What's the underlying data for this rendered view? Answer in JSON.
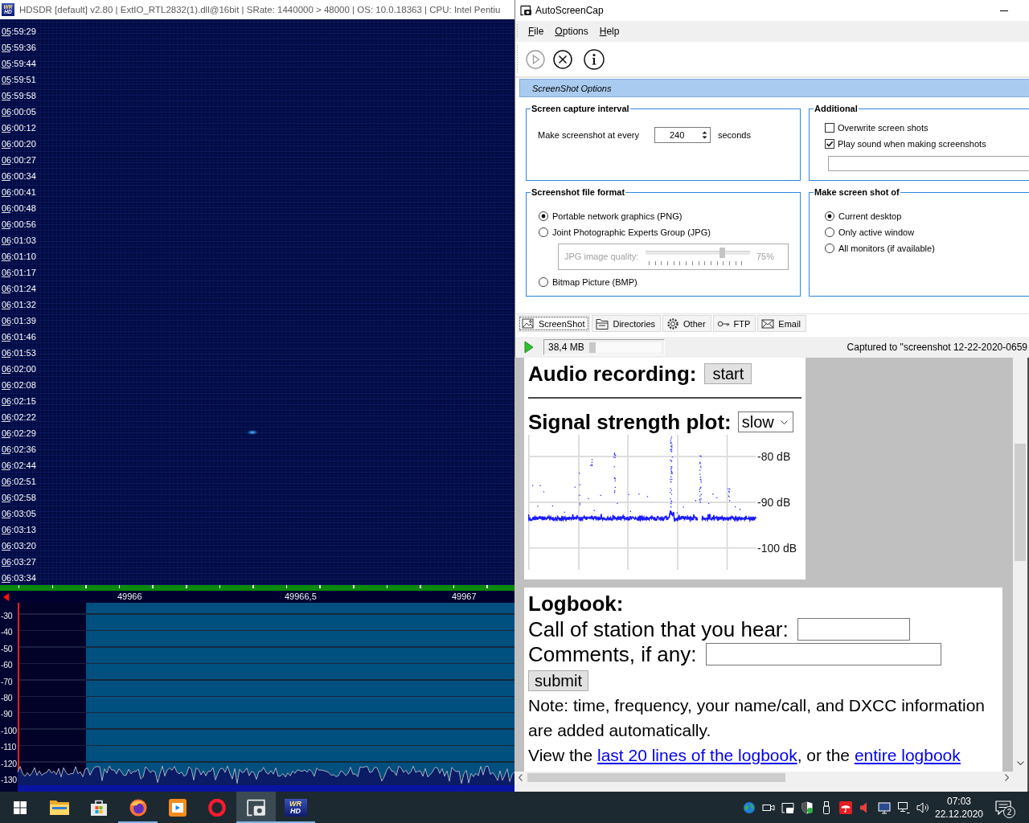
{
  "hdsdr": {
    "logo": [
      "WR",
      "HD"
    ],
    "title": "HDSDR [default] v2.80 | ExtIO_RTL2832(1).dll@16bit | SRate: 1440000 > 48000 | OS: 10.0.18363 | CPU: Intel Pentiu",
    "times": [
      "05:59:29",
      "05:59:36",
      "05:59:44",
      "05:59:51",
      "05:59:58",
      "06:00:05",
      "06:00:12",
      "06:00:20",
      "06:00:27",
      "06:00:34",
      "06:00:41",
      "06:00:48",
      "06:00:56",
      "06:01:03",
      "06:01:10",
      "06:01:17",
      "06:01:24",
      "06:01:32",
      "06:01:39",
      "06:01:46",
      "06:01:53",
      "06:02:00",
      "06:02:08",
      "06:02:15",
      "06:02:22",
      "06:02:29",
      "06:02:36",
      "06:02:44",
      "06:02:51",
      "06:02:58",
      "06:03:05",
      "06:03:13",
      "06:03:20",
      "06:03:27",
      "06:03:34"
    ],
    "frequency_labels": [
      "49966",
      "49966,5",
      "49967"
    ],
    "level_labels": [
      "-30",
      "-40",
      "-50",
      "-60",
      "-70",
      "-80",
      "-90",
      "-100",
      "-110",
      "-120",
      "-130"
    ]
  },
  "autoscreencap": {
    "title": "AutoScreenCap",
    "menu": [
      "File",
      "Options",
      "Help"
    ],
    "toolbar": [
      {
        "kind": "start",
        "disabled": true
      },
      {
        "kind": "stop",
        "disabled": false
      },
      {
        "kind": "info",
        "disabled": false
      }
    ],
    "section_header": "ScreenShot Options",
    "capture_interval": {
      "title": "Screen capture interval",
      "label": "Make screenshot at every",
      "value": "240",
      "unit": "seconds"
    },
    "additional": {
      "title": "Additional",
      "options": [
        {
          "label": "Overwrite screen shots",
          "checked": false
        },
        {
          "label": "Play sound when making screenshots",
          "checked": true
        }
      ]
    },
    "file_format": {
      "title": "Screenshot file format",
      "options": [
        {
          "label": "Portable network graphics (PNG)",
          "selected": true
        },
        {
          "label": "Joint Photographic Experts Group (JPG)",
          "selected": false,
          "quality": {
            "label": "JPG image quality:",
            "level": 0.75,
            "reading": "75%",
            "disabled": true
          }
        },
        {
          "label": "Bitmap Picture (BMP)",
          "selected": false
        }
      ]
    },
    "capture_target": {
      "title": "Make screen shot of",
      "options": [
        {
          "label": "Current desktop",
          "selected": true
        },
        {
          "label": "Only active window",
          "selected": false
        },
        {
          "label": "All monitors (if available)",
          "selected": false
        }
      ]
    },
    "tabs": [
      {
        "kind": "screenshot",
        "label": "ScreenShot",
        "selected": true
      },
      {
        "kind": "folder",
        "label": "Directories",
        "selected": false
      },
      {
        "kind": "gear",
        "label": "Other",
        "selected": false
      },
      {
        "kind": "key",
        "label": "FTP",
        "selected": false
      },
      {
        "kind": "mail",
        "label": "Email",
        "selected": false
      }
    ],
    "status_bar": {
      "size": "38,4 MB",
      "level": 0.09,
      "message": "Captured to \"screenshot 12-22-2020-0659"
    }
  },
  "web_page": {
    "audio": {
      "label": "Audio recording:",
      "button": "start"
    },
    "plot": {
      "label": "Signal strength plot:",
      "speed": "slow",
      "axis_labels": [
        "-80 dB",
        "-90 dB",
        "-100 dB"
      ]
    },
    "logbook": {
      "title": "Logbook:",
      "call_label": "Call of station that you hear:",
      "comments_label": "Comments, if any:",
      "submit": "submit",
      "note": "Note: time, frequency, your name/call, and DXCC information are added automatically.",
      "view": [
        {
          "kind": "text",
          "text": "View the "
        },
        {
          "kind": "link",
          "text": "last 20 lines of the logbook"
        },
        {
          "kind": "text",
          "text": ", or the "
        },
        {
          "kind": "link",
          "text": "entire logbook"
        }
      ]
    }
  },
  "taskbar": {
    "apps": [
      {
        "kind": "explorer",
        "running": false,
        "selected": false
      },
      {
        "kind": "store",
        "running": false,
        "selected": false
      },
      {
        "kind": "firefox",
        "running": true,
        "selected": false
      },
      {
        "kind": "media",
        "running": false,
        "selected": false
      },
      {
        "kind": "opera",
        "running": false,
        "selected": false
      },
      {
        "kind": "autoscreencap",
        "running": true,
        "selected": true
      },
      {
        "kind": "hdsdr",
        "running": true,
        "selected": false,
        "logo": [
          "WR",
          "HD"
        ]
      }
    ],
    "time": "07:03",
    "date": "22.12.2020",
    "notifications": "2"
  }
}
